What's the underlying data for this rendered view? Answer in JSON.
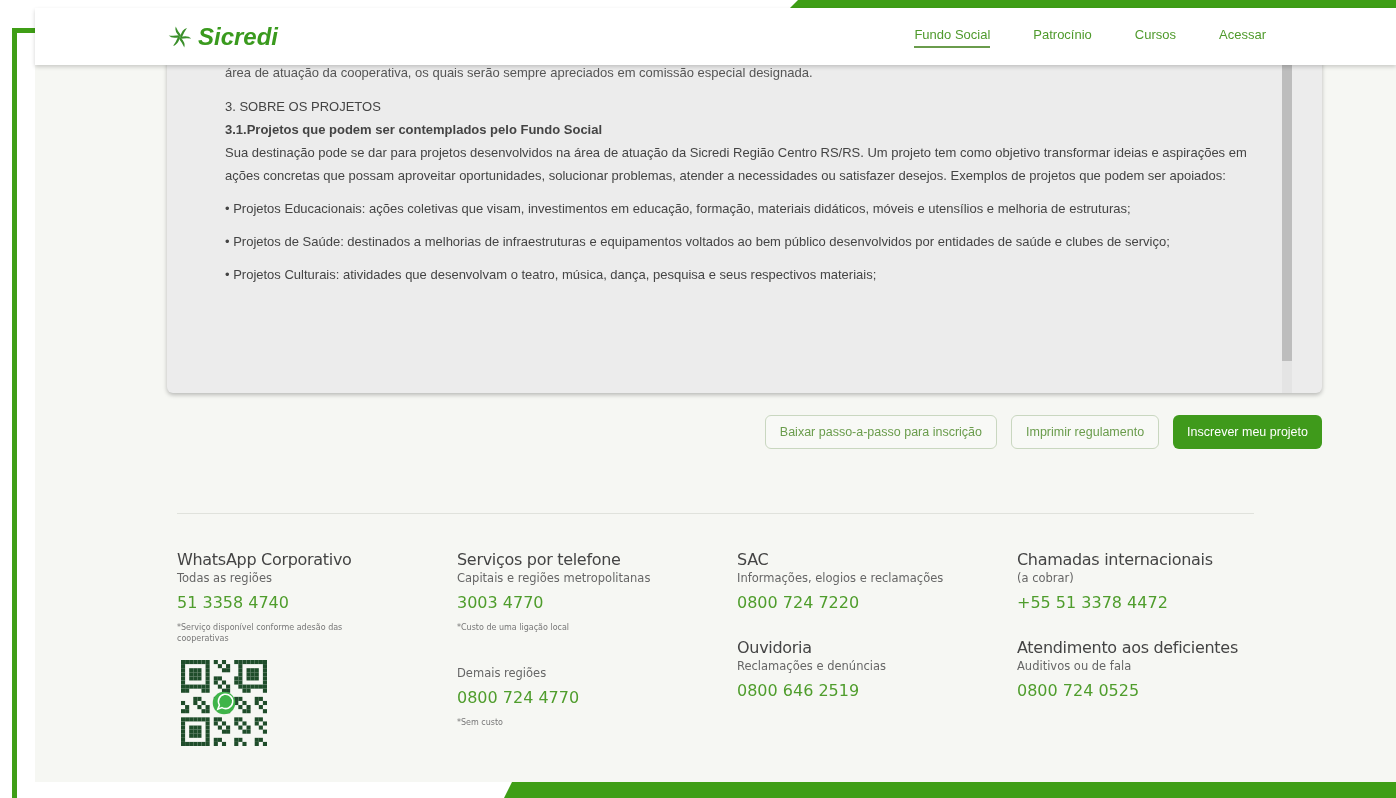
{
  "header": {
    "logo": "Sicredi",
    "nav": [
      {
        "label": "Fundo Social",
        "selected": true
      },
      {
        "label": "Patrocínio",
        "selected": false
      },
      {
        "label": "Cursos",
        "selected": false
      },
      {
        "label": "Acessar",
        "selected": false
      }
    ]
  },
  "rules": {
    "cut_line": "área de atuação da cooperativa, os quais serão sempre apreciados em comissão especial designada.",
    "section_title": "3. SOBRE OS PROJETOS",
    "subsection_title": "3.1.Projetos que podem ser contemplados pelo Fundo Social",
    "intro": "Sua destinação pode se dar para projetos desenvolvidos na área de atuação da Sicredi Região Centro RS/RS. Um projeto tem como objetivo transformar ideias e aspirações em ações concretas que possam aproveitar oportunidades, solucionar problemas, atender a necessidades ou satisfazer desejos. Exemplos de projetos que podem ser apoiados:",
    "items": [
      "• Projetos Educacionais: ações coletivas que visam, investimentos em educação, formação, materiais didáticos, móveis e utensílios e melhoria de estruturas;",
      "• Projetos de Saúde: destinados a melhorias de infraestruturas e equipamentos voltados ao bem público desenvolvidos por entidades de saúde e clubes de serviço;",
      "• Projetos Culturais: atividades que desenvolvam o teatro, música, dança, pesquisa e seus respectivos materiais;"
    ]
  },
  "actions": [
    {
      "label": "Baixar passo-a-passo para inscrição",
      "kind": "outline"
    },
    {
      "label": "Imprimir regulamento",
      "kind": "outline"
    },
    {
      "label": "Inscrever meu projeto",
      "kind": "primary"
    }
  ],
  "footer": {
    "columns": [
      [
        {
          "title": "WhatsApp Corporativo",
          "subtitle": "Todas as regiões",
          "phone": "51 3358 4740",
          "note": "*Serviço disponível conforme adesão das cooperativas",
          "qr": true
        }
      ],
      [
        {
          "title": "Serviços por telefone",
          "subtitle": "Capitais e regiões metropolitanas",
          "phone": "3003 4770",
          "note": "*Custo de uma ligação local"
        },
        {
          "subtitle": "Demais regiões",
          "phone": "0800 724 4770",
          "note": "*Sem custo"
        }
      ],
      [
        {
          "title": "SAC",
          "subtitle": "Informações, elogios e reclamações",
          "phone": "0800 724 7220"
        },
        {
          "title": "Ouvidoria",
          "subtitle": "Reclamações e denúncias",
          "phone": "0800 646 2519"
        }
      ],
      [
        {
          "title": "Chamadas internacionais",
          "subtitle": "(a cobrar)",
          "phone": "+55 51 3378 4472"
        },
        {
          "title": "Atendimento aos deficientes",
          "subtitle": "Auditivos ou de fala",
          "phone": "0800 724 0525"
        }
      ]
    ]
  }
}
